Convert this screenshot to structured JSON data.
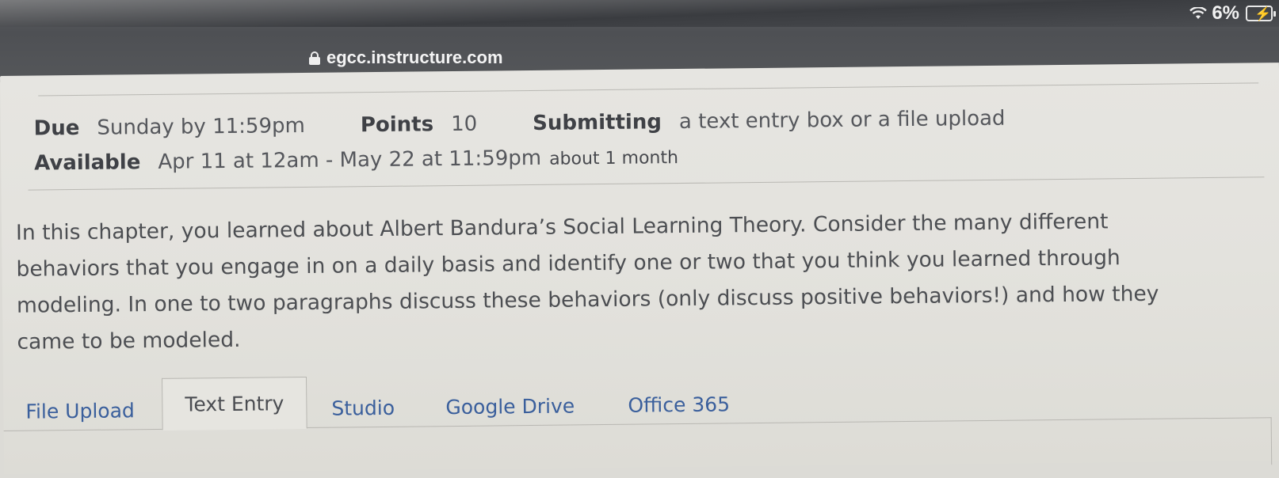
{
  "status_bar": {
    "battery_percent": "6%"
  },
  "browser": {
    "url": "egcc.instructure.com"
  },
  "assignment": {
    "due_label": "Due",
    "due_value": "Sunday by 11:59pm",
    "points_label": "Points",
    "points_value": "10",
    "submitting_label": "Submitting",
    "submitting_value": "a text entry box or a file upload",
    "available_label": "Available",
    "available_value": "Apr 11 at 12am - May 22 at 11:59pm",
    "available_duration": "about 1 month"
  },
  "description": {
    "lines": [
      "In this chapter, you learned about Albert Bandura’s Social Learning Theory. Consider the many different",
      "behaviors that you engage in on a daily basis and identify one or two that you think you learned through",
      "modeling. In one to two paragraphs discuss these behaviors (only discuss positive behaviors!) and how they",
      "came to be modeled."
    ]
  },
  "submission_tabs": {
    "items": [
      {
        "label": "File Upload"
      },
      {
        "label": "Text Entry"
      },
      {
        "label": "Studio"
      },
      {
        "label": "Google Drive"
      },
      {
        "label": "Office 365"
      }
    ],
    "active": "Text Entry"
  },
  "icons": {
    "wifi": "wifi-icon",
    "battery": "battery-charging-icon",
    "lock": "lock-icon"
  },
  "colors": {
    "link": "#3a5f9c",
    "text": "#4c4e52",
    "page_bg": "#e4e3de"
  }
}
